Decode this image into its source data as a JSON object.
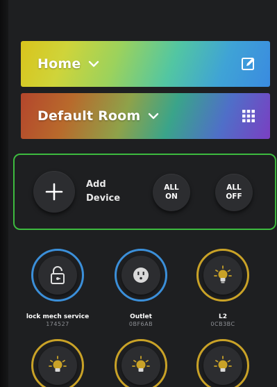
{
  "header": {
    "home_label": "Home",
    "room_label": "Default Room"
  },
  "add_panel": {
    "add_label_line1": "Add",
    "add_label_line2": "Device",
    "all_on_line1": "ALL",
    "all_on_line2": "ON",
    "all_off_line1": "ALL",
    "all_off_line2": "OFF"
  },
  "devices": [
    {
      "name": "lock mech service",
      "id": "174527",
      "icon": "lock-icon",
      "ring_color": "#3b8fd9"
    },
    {
      "name": "Outlet",
      "id": "0BF6AB",
      "icon": "outlet-icon",
      "ring_color": "#3b8fd9"
    },
    {
      "name": "L2",
      "id": "0CB3BC",
      "icon": "bulb-icon",
      "ring_color": "#c9a227"
    },
    {
      "name": "",
      "id": "",
      "icon": "bulb-icon",
      "ring_color": "#c9a227"
    },
    {
      "name": "",
      "id": "",
      "icon": "bulb-icon",
      "ring_color": "#c9a227"
    },
    {
      "name": "",
      "id": "",
      "icon": "bulb-icon",
      "ring_color": "#c9a227"
    }
  ],
  "colors": {
    "background": "#1e1f21",
    "panel_border": "#3dbb3f",
    "ring_blue": "#3b8fd9",
    "ring_gold": "#c9a227"
  }
}
